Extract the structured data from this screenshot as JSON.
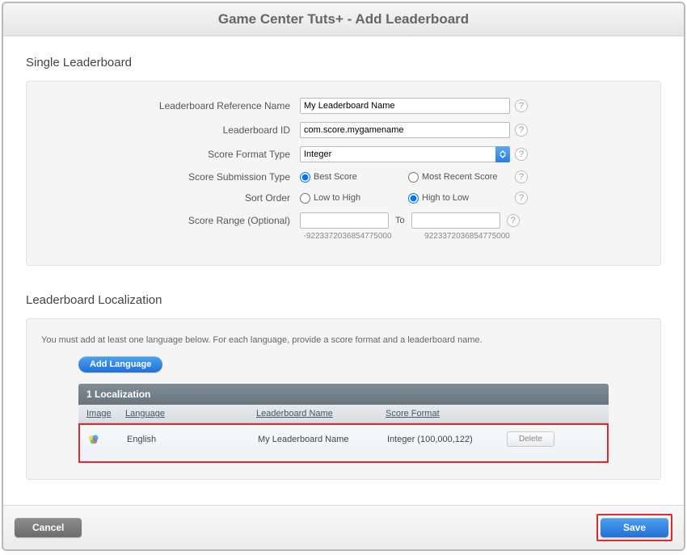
{
  "modal": {
    "title": "Game Center Tuts+ - Add Leaderboard"
  },
  "single": {
    "heading": "Single Leaderboard",
    "labels": {
      "refName": "Leaderboard Reference Name",
      "id": "Leaderboard ID",
      "formatType": "Score Format Type",
      "submissionType": "Score Submission Type",
      "sortOrder": "Sort Order",
      "range": "Score Range (Optional)"
    },
    "values": {
      "refName": "My Leaderboard Name",
      "id": "com.score.mygamename",
      "formatType": "Integer",
      "submissionBest": "Best Score",
      "submissionRecent": "Most Recent Score",
      "sortLow": "Low to High",
      "sortHigh": "High to Low",
      "rangeTo": "To",
      "rangeMinHint": "-9223372036854775000",
      "rangeMaxHint": "9223372036854775000"
    },
    "selection": {
      "submission": "best",
      "sort": "high"
    }
  },
  "localization": {
    "heading": "Leaderboard Localization",
    "instruction": "You must add at least one language below. For each language, provide a score format and a leaderboard name.",
    "addLanguage": "Add Language",
    "tableHeader": "1 Localization",
    "columns": {
      "image": "Image",
      "language": "Language",
      "name": "Leaderboard Name",
      "format": "Score Format"
    },
    "rows": [
      {
        "language": "English",
        "name": "My Leaderboard Name",
        "format": "Integer (100,000,122)",
        "deleteLabel": "Delete"
      }
    ]
  },
  "footer": {
    "cancel": "Cancel",
    "save": "Save"
  }
}
